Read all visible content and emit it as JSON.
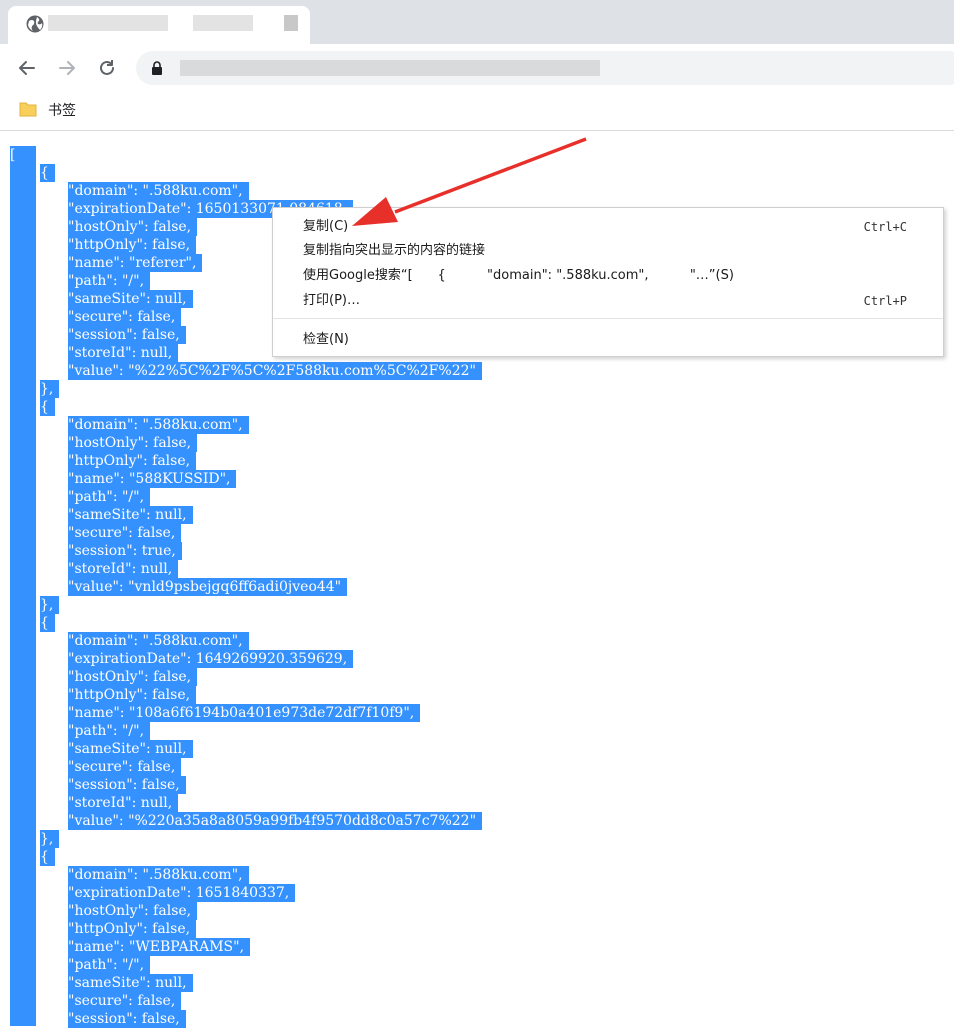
{
  "bookmarks": {
    "folder_label": "书签"
  },
  "json_lines": [
    {
      "text": "[",
      "indent": 0
    },
    {
      "text": "{",
      "indent": 1
    },
    {
      "text": "\"domain\": \".588ku.com\",",
      "indent": 2
    },
    {
      "text": "\"expirationDate\": 1650133071.084618,",
      "indent": 2
    },
    {
      "text": "\"hostOnly\": false,",
      "indent": 2
    },
    {
      "text": "\"httpOnly\": false,",
      "indent": 2
    },
    {
      "text": "\"name\": \"referer\",",
      "indent": 2
    },
    {
      "text": "\"path\": \"/\",",
      "indent": 2
    },
    {
      "text": "\"sameSite\": null,",
      "indent": 2
    },
    {
      "text": "\"secure\": false,",
      "indent": 2
    },
    {
      "text": "\"session\": false,",
      "indent": 2
    },
    {
      "text": "\"storeId\": null,",
      "indent": 2
    },
    {
      "text": "\"value\": \"%22%5C%2F%5C%2F588ku.com%5C%2F%22\"",
      "indent": 2
    },
    {
      "text": "},",
      "indent": 1
    },
    {
      "text": "{",
      "indent": 1
    },
    {
      "text": "\"domain\": \".588ku.com\",",
      "indent": 2
    },
    {
      "text": "\"hostOnly\": false,",
      "indent": 2
    },
    {
      "text": "\"httpOnly\": false,",
      "indent": 2
    },
    {
      "text": "\"name\": \"588KUSSID\",",
      "indent": 2
    },
    {
      "text": "\"path\": \"/\",",
      "indent": 2
    },
    {
      "text": "\"sameSite\": null,",
      "indent": 2
    },
    {
      "text": "\"secure\": false,",
      "indent": 2
    },
    {
      "text": "\"session\": true,",
      "indent": 2
    },
    {
      "text": "\"storeId\": null,",
      "indent": 2
    },
    {
      "text": "\"value\": \"vnld9psbejgq6ff6adi0jveo44\"",
      "indent": 2
    },
    {
      "text": "},",
      "indent": 1
    },
    {
      "text": "{",
      "indent": 1
    },
    {
      "text": "\"domain\": \".588ku.com\",",
      "indent": 2
    },
    {
      "text": "\"expirationDate\": 1649269920.359629,",
      "indent": 2
    },
    {
      "text": "\"hostOnly\": false,",
      "indent": 2
    },
    {
      "text": "\"httpOnly\": false,",
      "indent": 2
    },
    {
      "text": "\"name\": \"108a6f6194b0a401e973de72df7f10f9\",",
      "indent": 2
    },
    {
      "text": "\"path\": \"/\",",
      "indent": 2
    },
    {
      "text": "\"sameSite\": null,",
      "indent": 2
    },
    {
      "text": "\"secure\": false,",
      "indent": 2
    },
    {
      "text": "\"session\": false,",
      "indent": 2
    },
    {
      "text": "\"storeId\": null,",
      "indent": 2
    },
    {
      "text": "\"value\": \"%220a35a8a8059a99fb4f9570dd8c0a57c7%22\"",
      "indent": 2
    },
    {
      "text": "},",
      "indent": 1
    },
    {
      "text": "{",
      "indent": 1
    },
    {
      "text": "\"domain\": \".588ku.com\",",
      "indent": 2
    },
    {
      "text": "\"expirationDate\": 1651840337,",
      "indent": 2
    },
    {
      "text": "\"hostOnly\": false,",
      "indent": 2
    },
    {
      "text": "\"httpOnly\": false,",
      "indent": 2
    },
    {
      "text": "\"name\": \"WEBPARAMS\",",
      "indent": 2
    },
    {
      "text": "\"path\": \"/\",",
      "indent": 2
    },
    {
      "text": "\"sameSite\": null,",
      "indent": 2
    },
    {
      "text": "\"secure\": false,",
      "indent": 2
    },
    {
      "text": "\"session\": false,",
      "indent": 2
    }
  ],
  "context_menu": {
    "items": [
      {
        "label": "复制(C)",
        "shortcut": "Ctrl+C"
      },
      {
        "label": "复制指向突出显示的内容的链接",
        "shortcut": ""
      },
      {
        "label": "使用Google搜索“[      {          \"domain\": \".588ku.com\",          \"…”(S)",
        "shortcut": ""
      },
      {
        "label": "打印(P)…",
        "shortcut": "Ctrl+P"
      },
      {
        "label": "检查(N)",
        "shortcut": ""
      }
    ]
  },
  "colors": {
    "selection": "#3591fe",
    "arrow": "#e8302a",
    "tabstrip": "#dee1e6"
  },
  "icons": [
    "globe-icon",
    "back-arrow-icon",
    "forward-arrow-icon",
    "reload-icon",
    "lock-icon",
    "folder-icon"
  ]
}
